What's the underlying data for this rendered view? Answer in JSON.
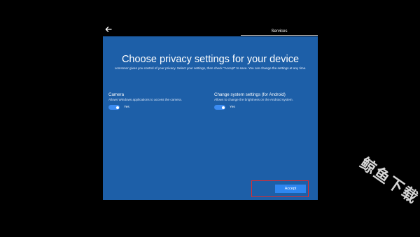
{
  "header": {
    "back_icon": "back-arrow-icon",
    "tab_label": "Services"
  },
  "dialog": {
    "title": "Choose privacy settings for your device",
    "description": "LonHonor gives you control of your privacy. Select your settings, then check \"Accept\" to save. You can change the settings at any time.",
    "settings": [
      {
        "title": "Camera",
        "description": "Allows Windows applications to access the camera.",
        "toggle_state": "on",
        "toggle_label": "Yes"
      },
      {
        "title": "Change system settings (for Android)",
        "description": "Allows to change the brightness on the Android system.",
        "toggle_state": "on",
        "toggle_label": "Yes"
      }
    ],
    "accept_label": "Accept"
  },
  "colors": {
    "panel": "#1d5fa8",
    "toggle_on": "#3c8cf2",
    "accept": "#2e86f0",
    "highlight": "#e22b2b"
  },
  "watermark": "鲸鱼下载"
}
